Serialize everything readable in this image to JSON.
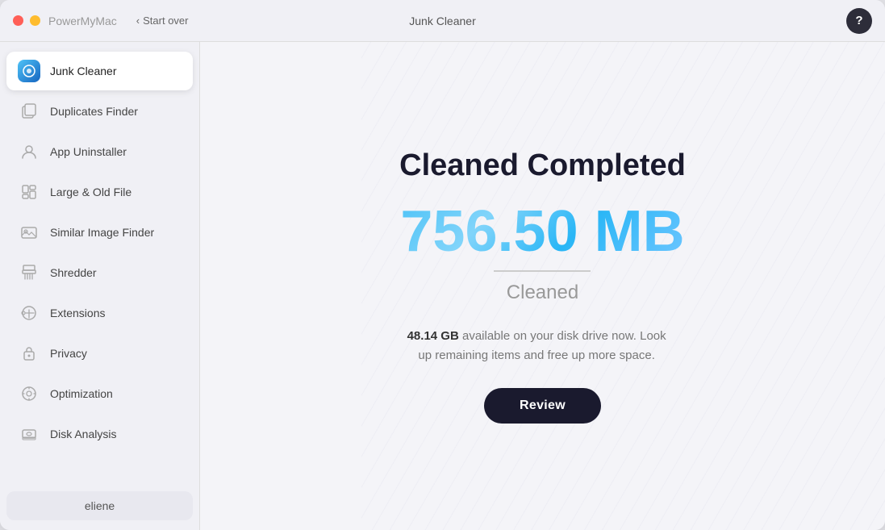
{
  "titleBar": {
    "appName": "PowerMyMac",
    "startOver": "Start over",
    "windowTitle": "Junk Cleaner",
    "helpLabel": "?"
  },
  "sidebar": {
    "items": [
      {
        "id": "junk-cleaner",
        "label": "Junk Cleaner",
        "active": true,
        "icon": "🔵"
      },
      {
        "id": "duplicates-finder",
        "label": "Duplicates Finder",
        "active": false,
        "icon": "📁"
      },
      {
        "id": "app-uninstaller",
        "label": "App Uninstaller",
        "active": false,
        "icon": "👤"
      },
      {
        "id": "large-old-file",
        "label": "Large & Old File",
        "active": false,
        "icon": "💼"
      },
      {
        "id": "similar-image-finder",
        "label": "Similar Image Finder",
        "active": false,
        "icon": "🖼"
      },
      {
        "id": "shredder",
        "label": "Shredder",
        "active": false,
        "icon": "🗄"
      },
      {
        "id": "extensions",
        "label": "Extensions",
        "active": false,
        "icon": "🔧"
      },
      {
        "id": "privacy",
        "label": "Privacy",
        "active": false,
        "icon": "🔒"
      },
      {
        "id": "optimization",
        "label": "Optimization",
        "active": false,
        "icon": "⚙"
      },
      {
        "id": "disk-analysis",
        "label": "Disk Analysis",
        "active": false,
        "icon": "💾"
      }
    ],
    "user": {
      "label": "eliene"
    }
  },
  "content": {
    "title": "Cleaned Completed",
    "sizeValue": "756.50 MB",
    "cleanedLabel": "Cleaned",
    "diskInfo": {
      "sizeAvailable": "48.14 GB",
      "description": " available on your disk drive now. Look up remaining items and free up more space."
    },
    "reviewButton": "Review"
  }
}
